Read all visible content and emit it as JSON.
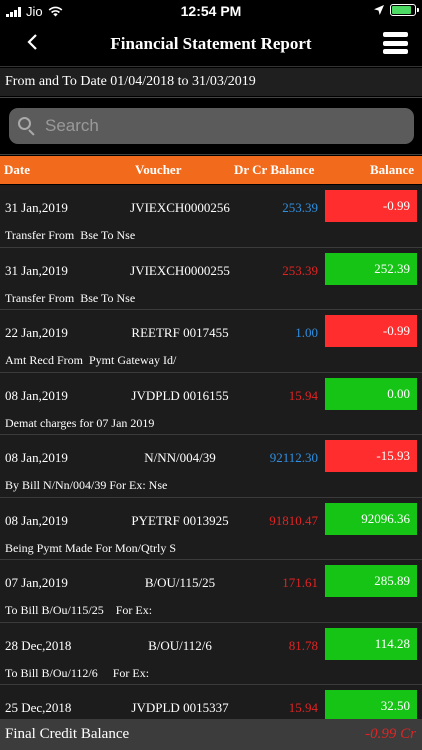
{
  "status_bar": {
    "carrier": "Jio",
    "time": "12:54 PM"
  },
  "nav": {
    "back_icon": "chevron-left-icon",
    "title": "Financial Statement Report",
    "menu_icon": "hamburger-menu-icon"
  },
  "date_range": "From and To Date 01/04/2018 to 31/03/2019",
  "search": {
    "placeholder": "Search",
    "value": ""
  },
  "table": {
    "headers": {
      "date": "Date",
      "voucher": "Voucher",
      "drcr": "Dr Cr Balance",
      "balance": "Balance"
    },
    "rows": [
      {
        "date": "31 Jan,2019",
        "voucher": "JVIEXCH0000256",
        "drcr": "253.39",
        "drcr_type": "credit",
        "balance": "-0.99",
        "balance_type": "negative",
        "narration": "Transfer From  Bse To Nse"
      },
      {
        "date": "31 Jan,2019",
        "voucher": "JVIEXCH0000255",
        "drcr": "253.39",
        "drcr_type": "debit",
        "balance": "252.39",
        "balance_type": "positive",
        "narration": "Transfer From  Bse To Nse"
      },
      {
        "date": "22 Jan,2019",
        "voucher": "REETRF 0017455",
        "drcr": "1.00",
        "drcr_type": "credit",
        "balance": "-0.99",
        "balance_type": "negative",
        "narration": "Amt Recd From  Pymt Gateway Id/"
      },
      {
        "date": "08 Jan,2019",
        "voucher": "JVDPLD 0016155",
        "drcr": "15.94",
        "drcr_type": "debit",
        "balance": "0.00",
        "balance_type": "positive",
        "narration": "Demat charges for 07 Jan 2019"
      },
      {
        "date": "08 Jan,2019",
        "voucher": "N/NN/004/39",
        "drcr": "92112.30",
        "drcr_type": "credit",
        "balance": "-15.93",
        "balance_type": "negative",
        "narration": "By Bill N/Nn/004/39 For Ex: Nse"
      },
      {
        "date": "08 Jan,2019",
        "voucher": "PYETRF 0013925",
        "drcr": "91810.47",
        "drcr_type": "debit",
        "balance": "92096.36",
        "balance_type": "positive",
        "narration": "Being Pymt Made For Mon/Qtrly S"
      },
      {
        "date": "07 Jan,2019",
        "voucher": "B/OU/115/25",
        "drcr": "171.61",
        "drcr_type": "debit",
        "balance": "285.89",
        "balance_type": "positive",
        "narration": "To Bill B/Ou/115/25    For Ex:"
      },
      {
        "date": "28 Dec,2018",
        "voucher": "B/OU/112/6",
        "drcr": "81.78",
        "drcr_type": "debit",
        "balance": "114.28",
        "balance_type": "positive",
        "narration": "To Bill B/Ou/112/6     For Ex:"
      },
      {
        "date": "25 Dec,2018",
        "voucher": "JVDPLD 0015337",
        "drcr": "15.94",
        "drcr_type": "debit",
        "balance": "32.50",
        "balance_type": "positive",
        "narration": ""
      }
    ]
  },
  "footer": {
    "label": "Final Credit Balance",
    "value": "-0.99 Cr"
  },
  "colors": {
    "header_bg": "#f26a1b",
    "credit_text": "#2f8fe0",
    "debit_text": "#e02424",
    "negative_bg": "#ff2d2d",
    "positive_bg": "#16c416",
    "footer_value": "#e02424"
  }
}
